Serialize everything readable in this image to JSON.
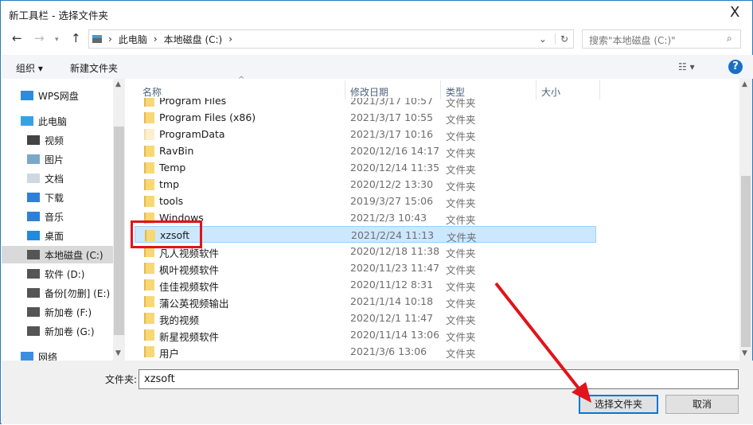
{
  "window": {
    "title": "新工具栏 - 选择文件夹",
    "close": "X"
  },
  "address": {
    "crumbs": [
      "此电脑",
      "本地磁盘 (C:)"
    ],
    "search_placeholder": "搜索\"本地磁盘 (C:)\""
  },
  "toolbar": {
    "organize": "组织 ▾",
    "new_folder": "新建文件夹",
    "help": "?",
    "view": "☷ ▾"
  },
  "sidebar": {
    "items": [
      {
        "label": "WPS网盘",
        "icon": "cloud-icon",
        "color": "#2b8be0"
      },
      {
        "label": "此电脑",
        "icon": "computer-icon",
        "color": "#3aa0e6"
      },
      {
        "label": "视频",
        "icon": "video-icon",
        "color": "#444"
      },
      {
        "label": "图片",
        "icon": "picture-icon",
        "color": "#7aa8c8"
      },
      {
        "label": "文档",
        "icon": "document-icon",
        "color": "#cfd8e0"
      },
      {
        "label": "下载",
        "icon": "download-icon",
        "color": "#2f7fd6"
      },
      {
        "label": "音乐",
        "icon": "music-icon",
        "color": "#2f7fd6"
      },
      {
        "label": "桌面",
        "icon": "desktop-icon",
        "color": "#1f8ae0"
      },
      {
        "label": "本地磁盘 (C:)",
        "icon": "drive-icon",
        "color": "#555"
      },
      {
        "label": "软件 (D:)",
        "icon": "drive-icon",
        "color": "#555"
      },
      {
        "label": "备份[勿删] (E:)",
        "icon": "drive-icon",
        "color": "#555"
      },
      {
        "label": "新加卷 (F:)",
        "icon": "drive-icon",
        "color": "#555"
      },
      {
        "label": "新加卷 (G:)",
        "icon": "drive-icon",
        "color": "#555"
      },
      {
        "label": "网络",
        "icon": "network-icon",
        "color": "#3a8ee0"
      }
    ]
  },
  "columns": [
    "名称",
    "修改日期",
    "类型",
    "大小"
  ],
  "files": [
    {
      "name": "Program Files",
      "date": "2021/3/17 10:57",
      "type": "文件夹"
    },
    {
      "name": "Program Files (x86)",
      "date": "2021/3/17 10:55",
      "type": "文件夹"
    },
    {
      "name": "ProgramData",
      "date": "2021/3/17 10:16",
      "type": "文件夹",
      "hidden": true
    },
    {
      "name": "RavBin",
      "date": "2020/12/16 14:17",
      "type": "文件夹"
    },
    {
      "name": "Temp",
      "date": "2020/12/14 11:35",
      "type": "文件夹"
    },
    {
      "name": "tmp",
      "date": "2020/12/2 13:30",
      "type": "文件夹"
    },
    {
      "name": "tools",
      "date": "2019/3/27 15:06",
      "type": "文件夹"
    },
    {
      "name": "Windows",
      "date": "2021/2/3 10:43",
      "type": "文件夹"
    },
    {
      "name": "xzsoft",
      "date": "2021/2/24 11:13",
      "type": "文件夹",
      "selected": true
    },
    {
      "name": "凡人视频软件",
      "date": "2020/12/18 11:38",
      "type": "文件夹"
    },
    {
      "name": "枫叶视频软件",
      "date": "2020/11/23 11:47",
      "type": "文件夹"
    },
    {
      "name": "佳佳视频软件",
      "date": "2020/11/12 8:31",
      "type": "文件夹"
    },
    {
      "name": "蒲公英视频输出",
      "date": "2021/1/14 10:18",
      "type": "文件夹"
    },
    {
      "name": "我的视频",
      "date": "2020/12/1 11:47",
      "type": "文件夹"
    },
    {
      "name": "新星视频软件",
      "date": "2020/11/14 13:06",
      "type": "文件夹"
    },
    {
      "name": "用户",
      "date": "2021/3/6 13:06",
      "type": "文件夹"
    }
  ],
  "footer": {
    "folder_label": "文件夹:",
    "folder_value": "xzsoft",
    "select": "选择文件夹",
    "cancel": "取消"
  }
}
